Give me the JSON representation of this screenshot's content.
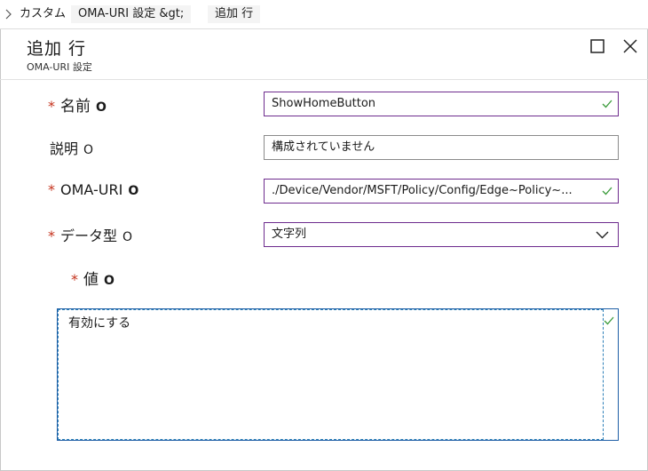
{
  "breadcrumb": {
    "items": [
      "カスタム",
      "OMA-URI 設定 &gt;",
      "追加 行"
    ]
  },
  "header": {
    "title": "追加 行",
    "subtitle": "OMA-URI 設定"
  },
  "form": {
    "required_mark": "*",
    "info_glyph": "O",
    "name": {
      "label": "名前",
      "value": "ShowHomeButton"
    },
    "description": {
      "label": "説明",
      "value": "構成されていません"
    },
    "oma_uri": {
      "label": "OMA-URI",
      "value": "./Device/Vendor/MSFT/Policy/Config/Edge~Policy~..."
    },
    "data_type": {
      "label": "データ型",
      "selected": "文字列"
    },
    "value": {
      "label": "値",
      "text": "有効にする"
    }
  },
  "colors": {
    "required": "#c5321c",
    "valid_check": "#3a9b3a",
    "field_border_active": "#6e2c8e",
    "value_box_border": "#1f5fa6"
  },
  "icons": [
    "chevron-right-icon",
    "maximize-icon",
    "close-icon",
    "checkmark-icon",
    "chevron-down-icon"
  ]
}
